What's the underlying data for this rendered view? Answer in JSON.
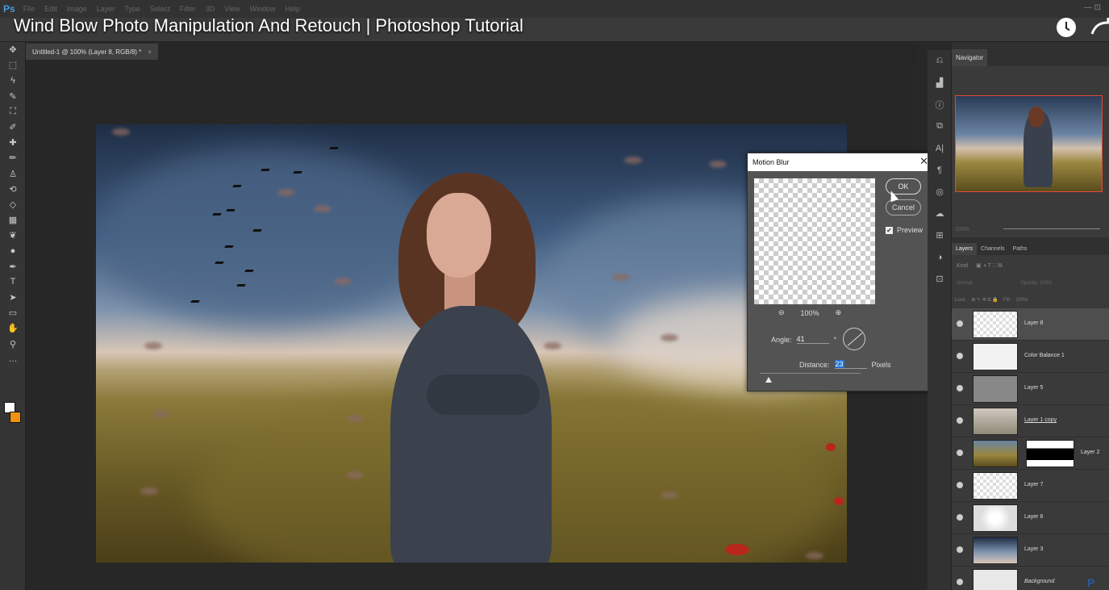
{
  "video": {
    "title": "Wind Blow Photo Manipulation And Retouch | Photoshop Tutorial"
  },
  "menubar": {
    "logo": "Ps",
    "items": [
      "File",
      "Edit",
      "Image",
      "Layer",
      "Type",
      "Select",
      "Filter",
      "3D",
      "View",
      "Window",
      "Help"
    ],
    "window_controls": "— ⊡"
  },
  "document": {
    "tab_label": "Untitled-1 @ 100% (Layer 8, RGB/8) *",
    "tab_close": "×"
  },
  "toolbar": {
    "tools": [
      "move-tool",
      "marquee-tool",
      "lasso-tool",
      "quick-select-tool",
      "crop-tool",
      "eyedropper-tool",
      "healing-tool",
      "brush-tool",
      "clone-stamp-tool",
      "history-brush-tool",
      "eraser-tool",
      "gradient-tool",
      "blur-tool",
      "dodge-tool",
      "pen-tool",
      "type-tool",
      "path-select-tool",
      "rectangle-tool",
      "hand-tool",
      "zoom-tool",
      "more-tools"
    ],
    "glyphs": [
      "✥",
      "⬚",
      "ϟ",
      "✎",
      "⛶",
      "✐",
      "✚",
      "✏",
      "♙",
      "⟲",
      "◇",
      "▦",
      "❦",
      "●",
      "✒",
      "T",
      "➤",
      "▭",
      "✋",
      "⚲",
      "…"
    ],
    "foreground_color": "#ffffff",
    "background_color": "#f0920f"
  },
  "dialog": {
    "title": "Motion Blur",
    "close": "✕",
    "ok_label": "OK",
    "cancel_label": "Cancel",
    "preview_label": "Preview",
    "preview_checked": true,
    "zoom_out_icon": "⊖",
    "zoom_level": "100%",
    "zoom_in_icon": "⊕",
    "angle_label": "Angle:",
    "angle_value": "41",
    "angle_unit": "°",
    "distance_label": "Distance:",
    "distance_value": "23",
    "distance_unit": "Pixels"
  },
  "dock": {
    "icons": [
      "history-icon",
      "histogram-icon",
      "info-icon",
      "clone-source-icon",
      "character-icon",
      "paragraph-icon",
      "swatches-icon",
      "adjustments-icon",
      "libraries-icon",
      "styles-icon",
      "properties-icon"
    ],
    "glyphs": [
      "⎌",
      "▟",
      "ⓘ",
      "⧉",
      "A|",
      "¶",
      "◎",
      "☁",
      "⊞",
      "◑",
      "⊡"
    ]
  },
  "navigator": {
    "tab": "Navigator",
    "zoom": "100%"
  },
  "layers_panel": {
    "tabs": [
      "Layers",
      "Channels",
      "Paths"
    ],
    "filter_label": "Kind",
    "filter_icons": "▣ ◑ T ⛶ ⧉",
    "blend_mode": "Normal",
    "opacity_label": "Opacity:",
    "opacity_value": "100%",
    "lock_label": "Lock:",
    "lock_icons": "⊠ ✎ ✥ ⧉ 🔒",
    "fill_label": "Fill:",
    "fill_value": "100%",
    "layers": [
      {
        "name": "Layer 8",
        "style": "selected"
      },
      {
        "name": "Color Balance 1",
        "style": "normal"
      },
      {
        "name": "Layer 5",
        "style": "normal"
      },
      {
        "name": "Layer 1 copy",
        "style": "underline"
      },
      {
        "name": "Layer 2",
        "style": "normal"
      },
      {
        "name": "Layer 7",
        "style": "normal"
      },
      {
        "name": "Layer 6",
        "style": "normal"
      },
      {
        "name": "Layer 3",
        "style": "normal"
      },
      {
        "name": "Background",
        "style": "italic"
      }
    ]
  },
  "corner_logo": "P"
}
